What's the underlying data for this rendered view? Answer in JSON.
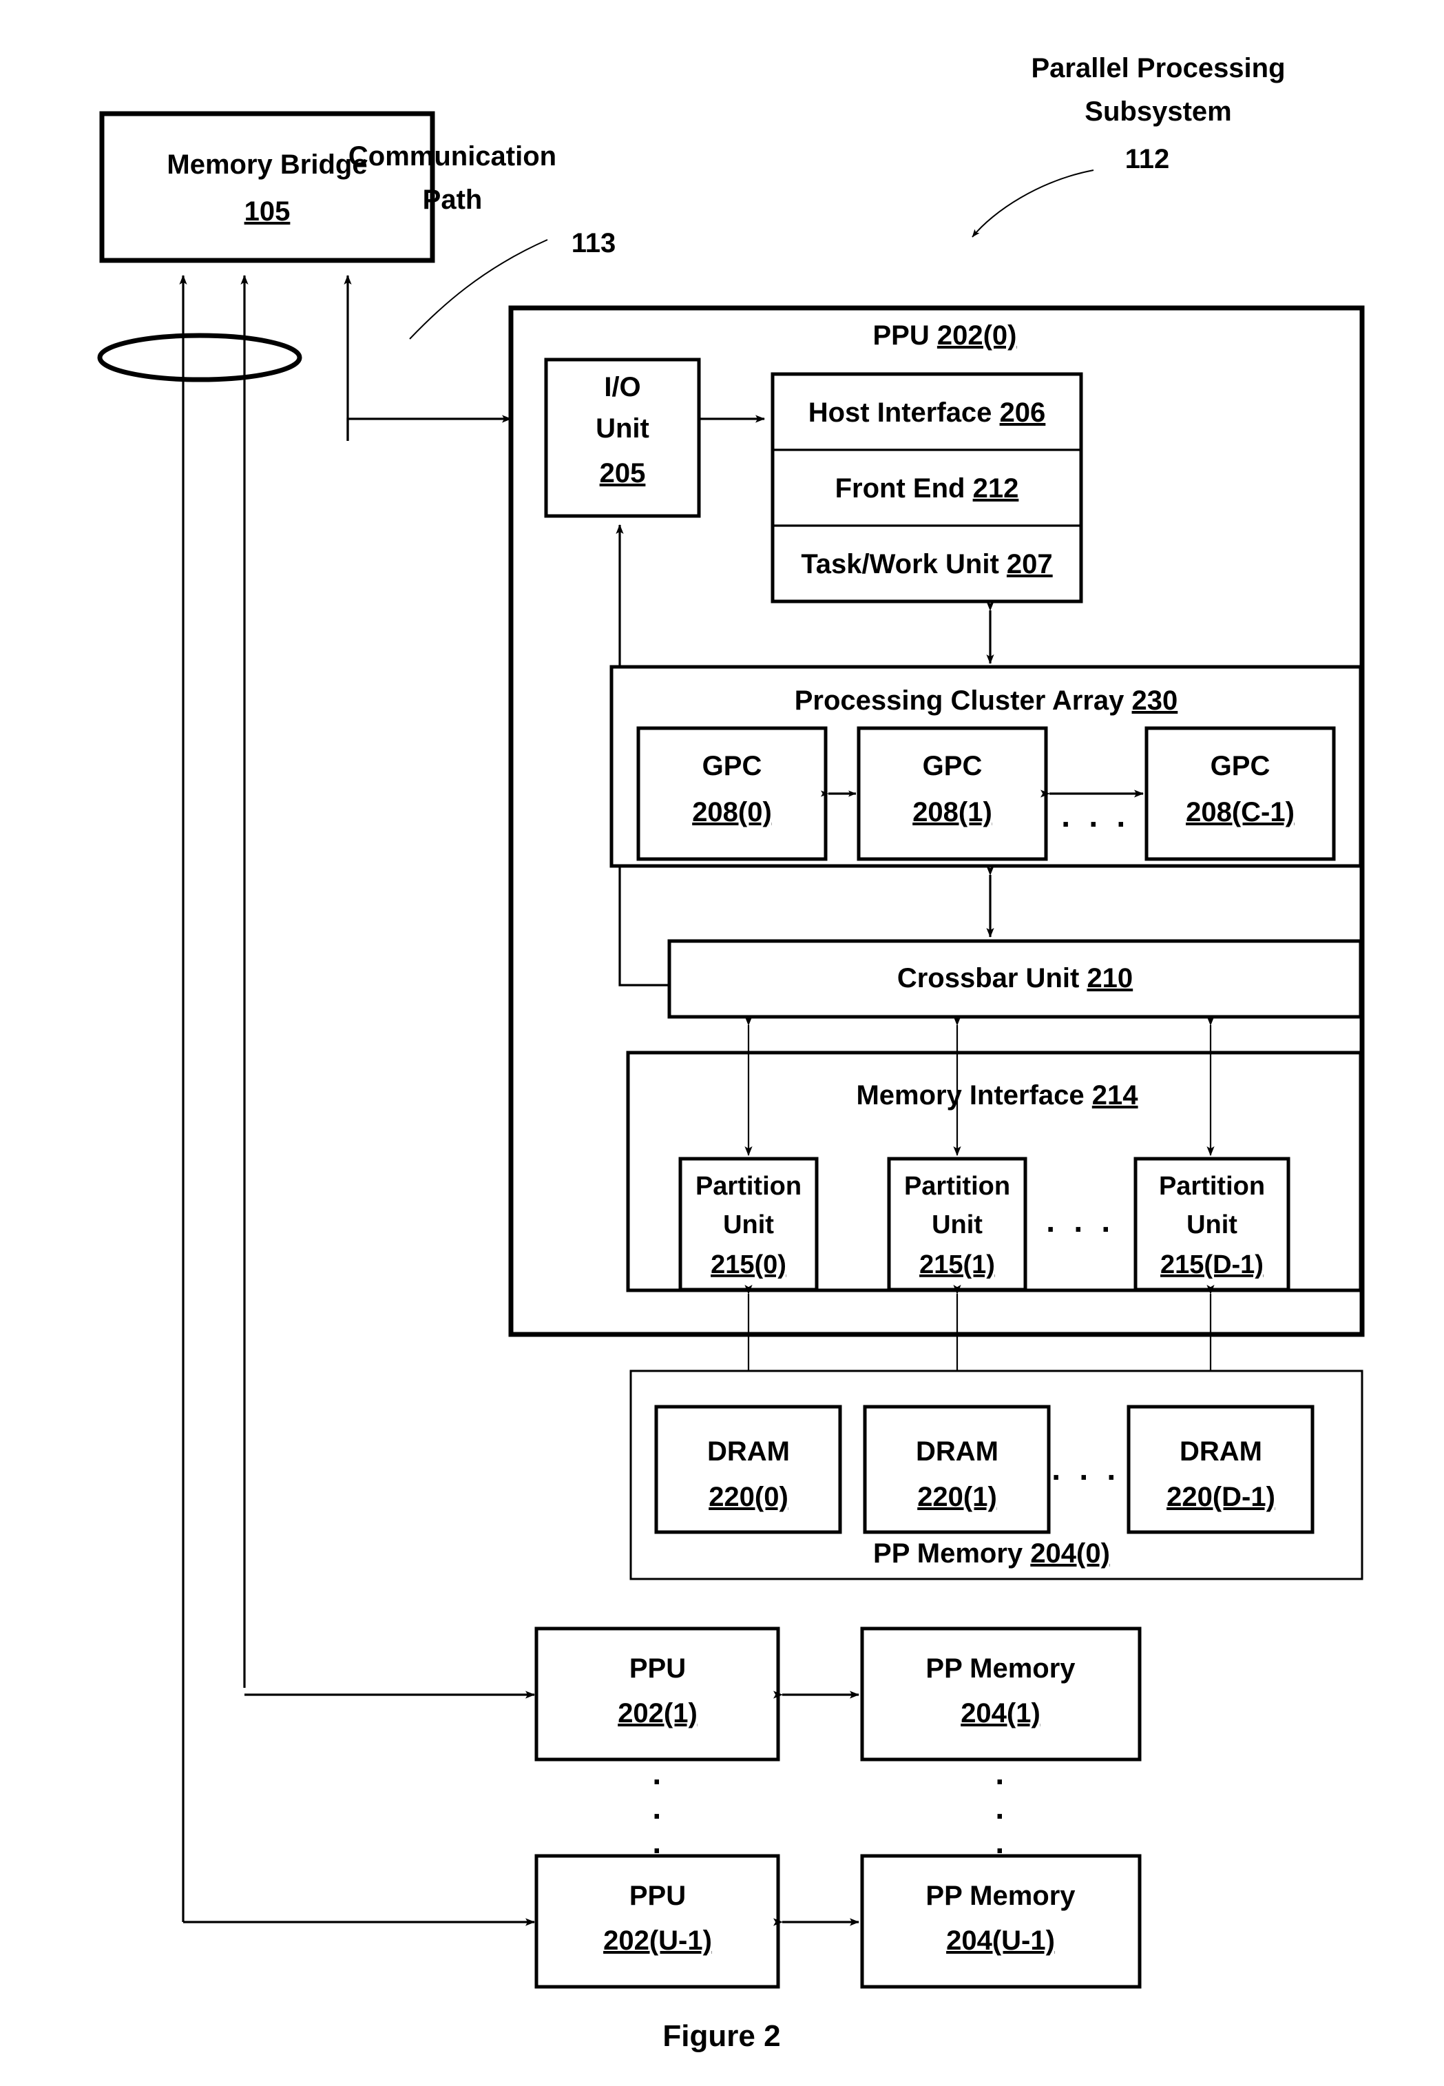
{
  "figure": {
    "caption": "Figure 2"
  },
  "labels": {
    "communication_path": {
      "line1": "Communication",
      "line2": "Path",
      "ref": "113"
    },
    "parallel_processing_subsystem": {
      "line1": "Parallel Processing",
      "line2": "Subsystem",
      "ref": "112"
    }
  },
  "memory_bridge": {
    "name": "Memory Bridge",
    "ref": "105"
  },
  "ppu0": {
    "title_name": "PPU",
    "title_ref": "202(0)",
    "io_unit": {
      "line1": "I/O",
      "line2": "Unit",
      "ref": "205"
    },
    "stack": [
      {
        "name": "Host Interface",
        "ref": "206"
      },
      {
        "name": "Front End",
        "ref": "212"
      },
      {
        "name": "Task/Work Unit",
        "ref": "207"
      }
    ],
    "processing_cluster_array": {
      "name": "Processing Cluster Array",
      "ref": "230",
      "gpcs": [
        {
          "name": "GPC",
          "ref": "208(0)"
        },
        {
          "name": "GPC",
          "ref": "208(1)"
        },
        {
          "name": "GPC",
          "ref": "208(C-1)"
        }
      ],
      "ellipsis": "· · ·"
    },
    "crossbar_unit": {
      "name": "Crossbar Unit",
      "ref": "210"
    },
    "memory_interface": {
      "name": "Memory Interface",
      "ref": "214",
      "partition_units": [
        {
          "line1": "Partition",
          "line2": "Unit",
          "ref": "215(0)"
        },
        {
          "line1": "Partition",
          "line2": "Unit",
          "ref": "215(1)"
        },
        {
          "line1": "Partition",
          "line2": "Unit",
          "ref": "215(D-1)"
        }
      ],
      "ellipsis": "· · ·"
    }
  },
  "pp_memory0": {
    "name": "PP Memory",
    "ref": "204(0)",
    "drams": [
      {
        "name": "DRAM",
        "ref": "220(0)"
      },
      {
        "name": "DRAM",
        "ref": "220(1)"
      },
      {
        "name": "DRAM",
        "ref": "220(D-1)"
      }
    ],
    "ellipsis": "· · ·"
  },
  "additional_units": {
    "vertical_ellipsis": "·",
    "rows": [
      {
        "ppu": {
          "name": "PPU",
          "ref": "202(1)"
        },
        "memory": {
          "name": "PP Memory",
          "ref": "204(1)"
        }
      },
      {
        "ppu": {
          "name": "PPU",
          "ref": "202(U-1)"
        },
        "memory": {
          "name": "PP Memory",
          "ref": "204(U-1)"
        }
      }
    ]
  },
  "colors": {
    "ink": "#000000",
    "paper": "#ffffff"
  }
}
